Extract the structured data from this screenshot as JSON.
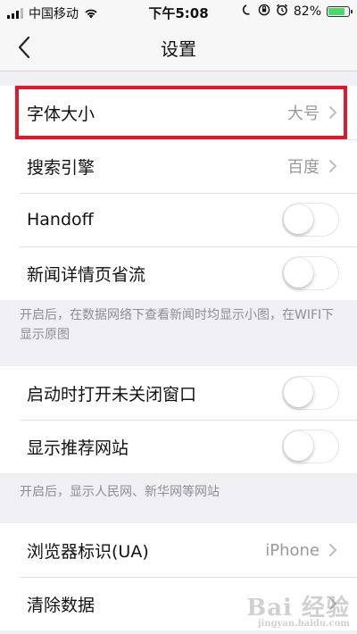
{
  "status_bar": {
    "carrier": "中国移动",
    "time": "下午5:08",
    "battery": "82%",
    "battery_level": 0.82,
    "icons": [
      "signal-icon",
      "wifi-icon",
      "moon-icon",
      "orientation-lock-icon",
      "alarm-icon",
      "battery-icon"
    ]
  },
  "nav": {
    "title": "设置",
    "back_icon": "chevron-left-icon"
  },
  "group1": {
    "font_size_label": "字体大小",
    "font_size_value": "大号",
    "search_engine_label": "搜索引擎",
    "search_engine_value": "百度",
    "handoff_label": "Handoff",
    "handoff_on": false,
    "news_saver_label": "新闻详情页省流",
    "news_saver_on": false
  },
  "note1": "开启后，在数据网络下查看新闻时均显示小图，在WIFI下显示原图",
  "group2": {
    "restore_tabs_label": "启动时打开未关闭窗口",
    "restore_tabs_on": false,
    "recommended_sites_label": "显示推荐网站",
    "recommended_sites_on": false
  },
  "note2": "开启后，显示人民网、新华网等网站",
  "group3": {
    "ua_label": "浏览器标识(UA)",
    "ua_value": "iPhone",
    "clear_data_label": "清除数据"
  },
  "watermark": "Bai 经验",
  "watermark_sub": "jingyan.baidu.com",
  "colors": {
    "highlight": "#e0182c",
    "battery": "#4cd964",
    "background": "#efeff4"
  }
}
